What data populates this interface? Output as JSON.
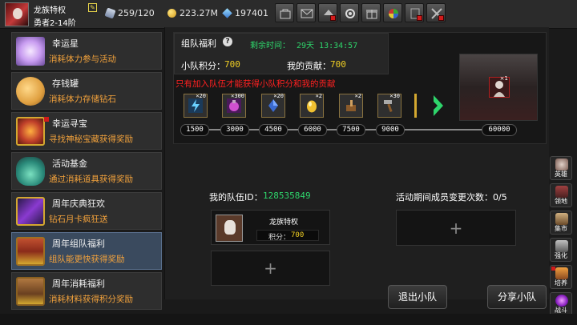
{
  "header": {
    "player_name": "龙族特权",
    "player_rank": "勇者2-14阶",
    "stamina": "259/120",
    "gold": "223.27M",
    "gems": "197401"
  },
  "toolbar": {
    "icons": [
      "shop-icon",
      "mail-icon",
      "event-icon",
      "settings-icon",
      "gift-icon",
      "wheel-icon",
      "pvp-icon",
      "battle-icon"
    ],
    "badges": [
      false,
      false,
      true,
      false,
      false,
      false,
      true,
      true
    ]
  },
  "menu": {
    "items": [
      {
        "title": "幸运星",
        "sub": "消耗体力参与活动",
        "badge": false
      },
      {
        "title": "存钱罐",
        "sub": "消耗体力存储钻石",
        "badge": false
      },
      {
        "title": "幸运寻宝",
        "sub": "寻找神秘宝藏获得奖励",
        "badge": true
      },
      {
        "title": "活动基金",
        "sub": "通过消耗道具获得奖励",
        "badge": false
      },
      {
        "title": "周年庆典狂欢",
        "sub": "钻石月卡疯狂送",
        "badge": false
      },
      {
        "title": "周年组队福利",
        "sub": "组队能更快获得奖励",
        "badge": false
      },
      {
        "title": "周年消耗福利",
        "sub": "消耗材料获得积分奖励",
        "badge": false
      }
    ]
  },
  "reward": {
    "title": "组队福利",
    "time_label": "剩余时间：",
    "time_value": "29天 13:34:57",
    "score_label": "小队积分：",
    "score_value": "700",
    "contrib_label": "我的贡献：",
    "contrib_value": "700",
    "warning": "只有加入队伍才能获得小队积分和我的贡献",
    "items": [
      {
        "qty": "×20",
        "icon": "lightning-scroll-icon"
      },
      {
        "qty": "×300",
        "icon": "potion-box-icon"
      },
      {
        "qty": "×20",
        "icon": "blue-crystal-icon"
      },
      {
        "qty": "×2",
        "icon": "golden-egg-icon"
      },
      {
        "qty": "×2",
        "icon": "hammer-scroll-icon"
      },
      {
        "qty": "×30",
        "icon": "hammer-icon"
      }
    ],
    "milestones": [
      "1500",
      "3000",
      "4500",
      "6000",
      "7500",
      "9000",
      "60000"
    ],
    "big_reward_qty": "×1"
  },
  "team": {
    "id_label": "我的队伍ID：",
    "id_value": "128535849",
    "change_label": "活动期间成员变更次数：0/5",
    "member_name": "龙族特权",
    "member_score_label": "积分：",
    "member_score": "700",
    "plus": "+",
    "leave_button": "退出小队",
    "share_button": "分享小队"
  },
  "side": {
    "items": [
      {
        "label": "英雄",
        "icon": "hero-icon",
        "badge": false
      },
      {
        "label": "领地",
        "icon": "territory-icon",
        "badge": false
      },
      {
        "label": "集市",
        "icon": "market-icon",
        "badge": false
      },
      {
        "label": "强化",
        "icon": "enhance-icon",
        "badge": false
      },
      {
        "label": "培养",
        "icon": "cultivate-icon",
        "badge": true
      },
      {
        "label": "战斗",
        "icon": "battle-portal-icon",
        "badge": false
      }
    ]
  },
  "colors": {
    "gold_text": "#f2d024",
    "green_text": "#2ed56b",
    "warning_red": "#ff2020",
    "menu_sub": "#f2a23c"
  }
}
